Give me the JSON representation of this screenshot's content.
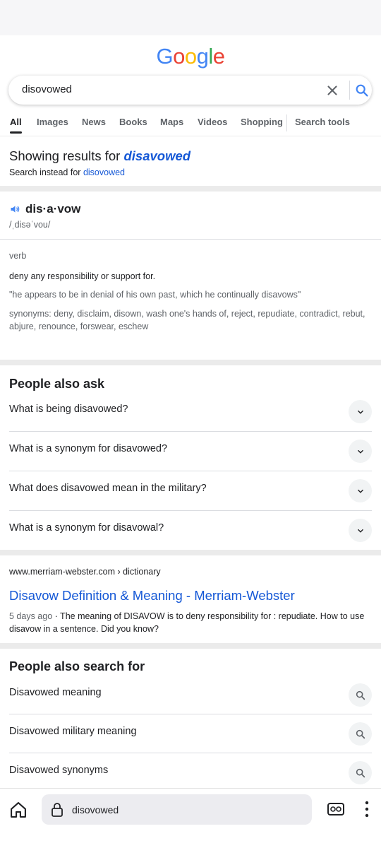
{
  "logo": {
    "letters": [
      {
        "char": "G",
        "color": "#4285F4"
      },
      {
        "char": "o",
        "color": "#EA4335"
      },
      {
        "char": "o",
        "color": "#FBBC05"
      },
      {
        "char": "g",
        "color": "#4285F4"
      },
      {
        "char": "l",
        "color": "#34A853"
      },
      {
        "char": "e",
        "color": "#EA4335"
      }
    ]
  },
  "search": {
    "query": "disovowed",
    "clear_icon": "close-icon",
    "submit_icon": "search-icon"
  },
  "tabs": [
    "All",
    "Images",
    "News",
    "Books",
    "Maps",
    "Videos",
    "Shopping",
    "Search tools"
  ],
  "spelling": {
    "showing_prefix": "Showing results for",
    "corrected": "disavowed",
    "instead_prefix": "Search instead for",
    "original": "disovowed"
  },
  "dictionary": {
    "word": "dis·a·vow",
    "pronunciation": "/ˌdisəˈvou/",
    "part_of_speech": "verb",
    "definition": "deny any responsibility or support for.",
    "example": "\"he appears to be in denial of his own past, which he continually disavows\"",
    "synonyms_line1": "synonyms: deny, disclaim, disown, wash one's hands of, reject, repudiate, contradict, rebut,",
    "synonyms_line2": "abjure, renounce, forswear, eschew"
  },
  "people_also_ask": {
    "heading": "People also ask",
    "questions": [
      "What is being disavowed?",
      "What is a synonym for disavowed?",
      "What does disavowed mean in the military?",
      "What is a synonym for disavowal?"
    ]
  },
  "result": {
    "cite": "www.merriam-webster.com › dictionary",
    "title": "Disavow Definition & Meaning - Merriam-Webster",
    "date": "5 days ago",
    "snippet_line1": " · The meaning of DISAVOW is to deny responsibility for : repudiate. How to use",
    "snippet_line2": "disavow in a sentence. Did you know?"
  },
  "people_also_search": {
    "heading": "People also search for",
    "items": [
      "Disavowed meaning",
      "Disavowed military meaning",
      "Disavowed synonyms"
    ]
  },
  "browser": {
    "url": "disovowed",
    "accent": "#1558d6"
  }
}
